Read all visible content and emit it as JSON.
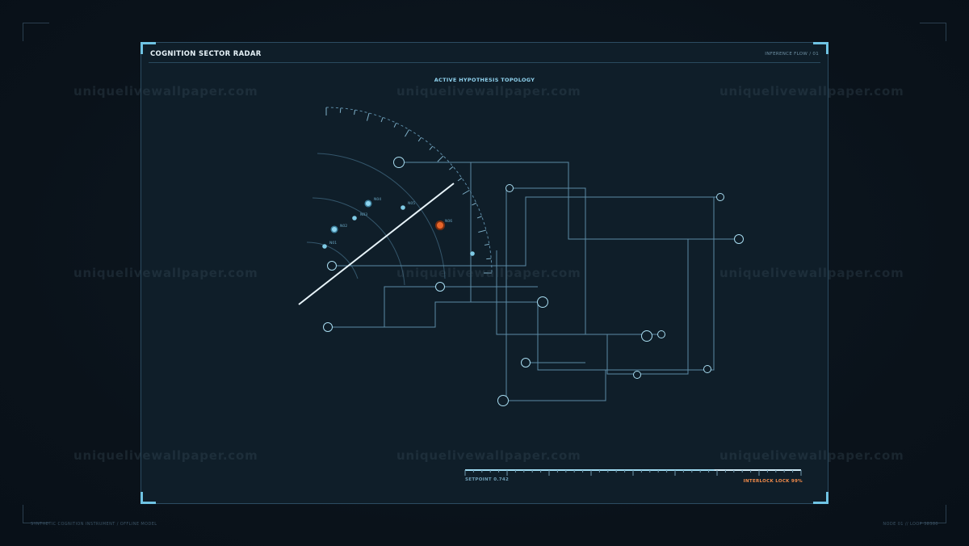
{
  "panel": {
    "title": "COGNITION SECTOR RADAR",
    "right_label": "INFERENCE FLOW / 01",
    "topology_title": "ACTIVE HYPOTHESIS TOPOLOGY"
  },
  "radar_nodes": [
    {
      "id": "N01",
      "label": "N01",
      "active": false
    },
    {
      "id": "N02",
      "label": "N02",
      "active": false
    },
    {
      "id": "N03",
      "label": "N03",
      "active": false
    },
    {
      "id": "N04",
      "label": "N04",
      "active": false
    },
    {
      "id": "N05",
      "label": "N05",
      "active": false
    },
    {
      "id": "N06",
      "label": "N06",
      "active": true
    }
  ],
  "setpoint": {
    "label": "SETPOINT 0.742",
    "value": 0.742
  },
  "interlock": {
    "label": "INTERLOCK LOCK  99%",
    "value": 99
  },
  "footer": {
    "left": "SYNTHETIC COGNITION INSTRUMENT / OFFLINE MODEL",
    "right": "NODE 01 // LOOP 38380"
  },
  "watermark": "uniquelivewallpaper.com",
  "colors": {
    "accent": "#8fd2ee",
    "alert": "#e8652a",
    "line": "#5b8aa5"
  }
}
